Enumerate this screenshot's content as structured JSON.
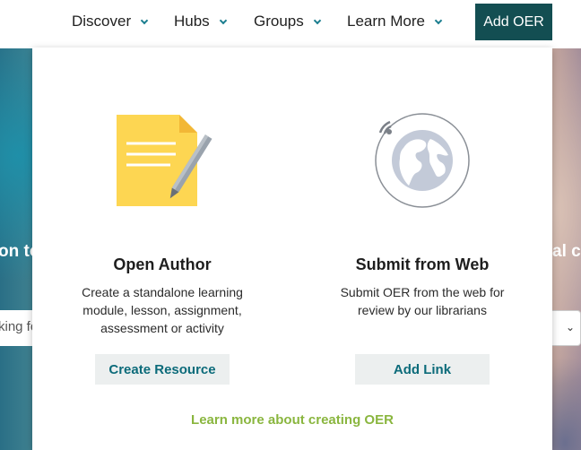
{
  "nav": {
    "items": [
      {
        "label": "Discover"
      },
      {
        "label": "Hubs"
      },
      {
        "label": "Groups"
      },
      {
        "label": "Learn More"
      }
    ],
    "add_oer_label": "Add OER"
  },
  "hero": {
    "left_text": "on to",
    "right_text": "al cit",
    "search_fragment": "king fo"
  },
  "panel": {
    "open_author": {
      "title": "Open Author",
      "description": "Create a standalone learning module, lesson, assignment, assessment or activity",
      "button_label": "Create Resource",
      "icon": "document-pencil-icon"
    },
    "submit_web": {
      "title": "Submit from Web",
      "description": "Submit OER from the web for review by our librarians",
      "button_label": "Add Link",
      "icon": "globe-icon"
    },
    "learn_more_link": "Learn more about creating OER"
  },
  "colors": {
    "accent_teal": "#134e52",
    "link_teal": "#0c6b7a",
    "learn_more_green": "#8ab63f"
  }
}
